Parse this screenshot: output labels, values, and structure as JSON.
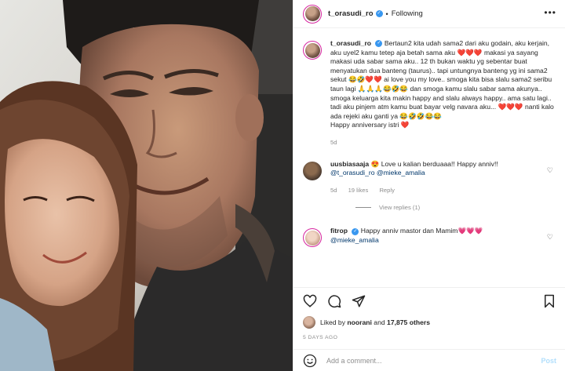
{
  "header": {
    "username": "t_orasudi_ro",
    "verified_badge": "✓",
    "separator": "•",
    "follow_status": "Following",
    "more_icon": "•••"
  },
  "caption": {
    "username": "t_orasudi_ro",
    "verified_badge": "✓",
    "text_1": " Bertaun2 kita udah sama2 dari aku godain, aku kerjain, aku uyel2 kamu tetep aja betah sama aku ",
    "emoji_1": "❤️❤️❤️",
    "text_2": " makasi ya sayang makasi uda sabar sama aku.. 12 th bukan waktu yg sebentar buat menyatukan dua banteng (taurus).. tapi untungnya banteng yg ini sama2 sekut ",
    "emoji_2": "😂🤣❤️❤️",
    "text_3": " ai love you my love.. smoga kita bisa slalu sama2 seribu taun lagi ",
    "emoji_3": "🙏🙏🙏😂🤣😂",
    "text_4": " dan smoga kamu slalu sabar sama akunya.. smoga keluarga kita makin happy and slalu always happy.. ama satu lagi.. tadi aku pinjem atm kamu buat bayar velg navara aku... ",
    "emoji_4": "❤️❤️❤️",
    "text_5": " nanti kalo ada rejeki aku ganti ya ",
    "emoji_5": "😂🤣🤣😂😂",
    "text_6": "Happy anniversary istri ",
    "emoji_6": "❤️",
    "time": "5d"
  },
  "comments": [
    {
      "username": "uusbiasaaja",
      "text": "Love u kalian berduaaa!! Happy anniv!!",
      "emoji": "😍",
      "mention": "@t_orasudi_ro",
      "mention_2": "@mieke_amalia",
      "time": "5d",
      "likes": "19 likes",
      "reply": "Reply",
      "view_replies": "View replies (1)",
      "like_icon": "♡"
    },
    {
      "username": "fitrop",
      "verified_badge": "✓",
      "text": "Happy anniv mastor dan Mamim",
      "emoji": "💗💗💗",
      "mention": "@mieke_amalia",
      "like_icon": "♡"
    }
  ],
  "icons": [
    "heart-icon",
    "comment-icon",
    "share-icon",
    "bookmark-icon",
    "emoji-icon"
  ],
  "likes": {
    "prefix": "Liked by ",
    "user": "noorani",
    "middle": " and ",
    "count": "17,875 others"
  },
  "date": "5 DAYS AGO",
  "add_comment": {
    "placeholder": "Add a comment...",
    "post_label": "Post"
  }
}
